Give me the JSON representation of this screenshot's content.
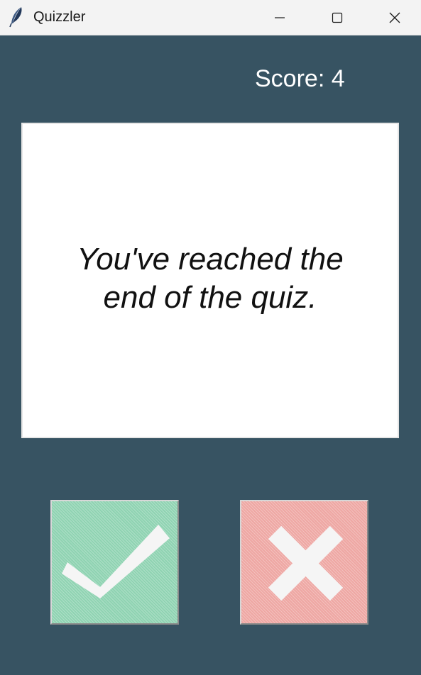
{
  "window": {
    "title": "Quizzler",
    "controls": {
      "minimize_icon": "minimize-icon",
      "maximize_icon": "maximize-icon",
      "close_icon": "close-icon"
    }
  },
  "score": {
    "label": "Score: 4"
  },
  "question": {
    "text": "You've reached the end of the quiz."
  },
  "buttons": {
    "true_icon": "check-icon",
    "false_icon": "cross-icon"
  },
  "colors": {
    "background": "#375362",
    "card": "#ffffff",
    "true_button": "#8fd3b2",
    "false_button": "#eea7a3",
    "icon": "#f5f5f5"
  }
}
